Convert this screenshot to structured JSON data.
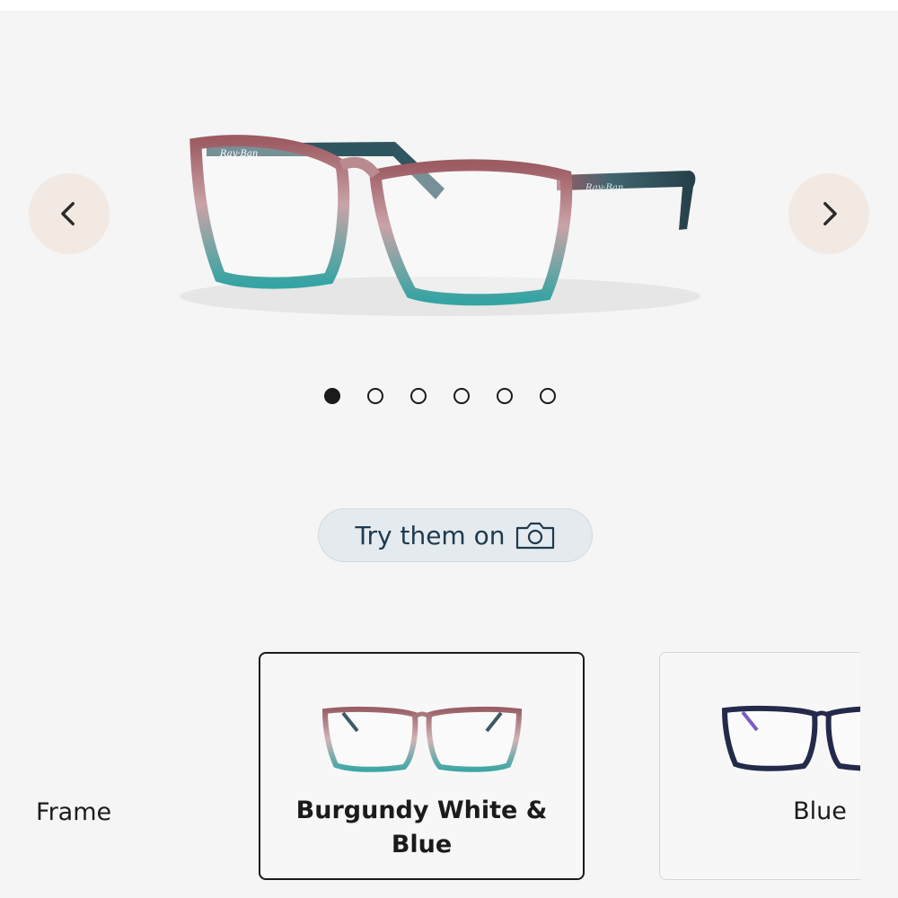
{
  "carousel": {
    "prev_icon": "chevron-left-icon",
    "next_icon": "chevron-right-icon",
    "slide_count": 6,
    "active_index": 0
  },
  "try_on": {
    "label": "Try them on",
    "icon": "camera-icon"
  },
  "frame": {
    "label": "Frame",
    "options": [
      {
        "name": "Burgundy White & Blue",
        "selected": true
      },
      {
        "name": "Blue",
        "selected": false
      }
    ]
  },
  "colors": {
    "nav_bg": "#f1e9e2",
    "button_bg": "#e4eaee",
    "button_text": "#1f3a4d"
  }
}
